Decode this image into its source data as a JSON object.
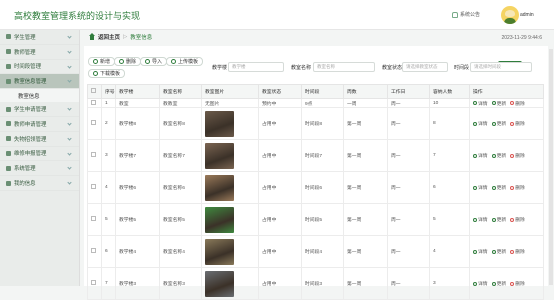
{
  "header": {
    "app_title": "高校教室管理系统的设计与实现",
    "announcement": "系统公告",
    "username": "admin"
  },
  "sidebar": {
    "items": [
      {
        "label": "学生管理",
        "active": false
      },
      {
        "label": "教师管理",
        "active": false
      },
      {
        "label": "时间段管理",
        "active": false
      },
      {
        "label": "教室信息管理",
        "active": true
      },
      {
        "label": "学生申请管理",
        "active": false
      },
      {
        "label": "教师申请管理",
        "active": false
      },
      {
        "label": "失物招领管理",
        "active": false
      },
      {
        "label": "维修申报管理",
        "active": false
      },
      {
        "label": "系统管理",
        "active": false
      },
      {
        "label": "我的信息",
        "active": false
      }
    ],
    "sub_item": "教室信息"
  },
  "breadcrumb": {
    "home": "返回主页",
    "current": "教室信息"
  },
  "datetime": "2023-11-29 9:44:6",
  "toolbar": {
    "add": "新增",
    "delete": "删除",
    "import": "导入",
    "upload_template": "上传模板",
    "download_template": "下载模板"
  },
  "search": {
    "label_building": "教学楼",
    "placeholder_building": "教学楼",
    "label_room": "教室名称",
    "placeholder_room": "教室名称",
    "label_status": "教室状态",
    "placeholder_status": "请选择教室状态",
    "label_timeslot": "时间段",
    "placeholder_timeslot": "请选择时间段",
    "button": "搜索"
  },
  "table": {
    "headers": [
      "",
      "序号",
      "教学楼",
      "教室名称",
      "教室图片",
      "教室状态",
      "时间段",
      "周数",
      "工作日",
      "容纳人数",
      "操作"
    ],
    "first_row": {
      "no": "1",
      "building": "教室",
      "room": "教教室",
      "image": "无图片",
      "status": "预约中",
      "timeslot": "9点",
      "week": "一周",
      "weekday": "周一",
      "capacity": "10"
    },
    "rows": [
      {
        "no": "2",
        "building": "教学楼8",
        "room": "教室名称8",
        "status": "占用中",
        "timeslot": "时间段8",
        "week": "第一周",
        "weekday": "周一",
        "capacity": "8",
        "thumb": "#6b5a4a"
      },
      {
        "no": "3",
        "building": "教学楼7",
        "room": "教室名称7",
        "status": "占用中",
        "timeslot": "时间段7",
        "week": "第一周",
        "weekday": "周一",
        "capacity": "7",
        "thumb": "#7b6552"
      },
      {
        "no": "4",
        "building": "教学楼6",
        "room": "教室名称6",
        "status": "占用中",
        "timeslot": "时间段6",
        "week": "第一周",
        "weekday": "周一",
        "capacity": "6",
        "thumb": "#9a7a5a"
      },
      {
        "no": "5",
        "building": "教学楼5",
        "room": "教室名称5",
        "status": "占用中",
        "timeslot": "时间段5",
        "week": "第一周",
        "weekday": "周一",
        "capacity": "5",
        "thumb": "#3f8a3f"
      },
      {
        "no": "6",
        "building": "教学楼4",
        "room": "教室名称4",
        "status": "占用中",
        "timeslot": "时间段4",
        "week": "第一周",
        "weekday": "周一",
        "capacity": "4",
        "thumb": "#8a7a5a"
      },
      {
        "no": "7",
        "building": "教学楼3",
        "room": "教室名称3",
        "status": "占用中",
        "timeslot": "时间段3",
        "week": "第一周",
        "weekday": "周一",
        "capacity": "3",
        "thumb": "#6a6e72"
      }
    ],
    "actions": {
      "detail": "详情",
      "edit": "更新",
      "delete": "删除"
    }
  },
  "colors": {
    "accent": "#2f7d3c",
    "detail": "#2f7d3c",
    "edit": "#2f7d3c",
    "delete": "#d9534f"
  }
}
